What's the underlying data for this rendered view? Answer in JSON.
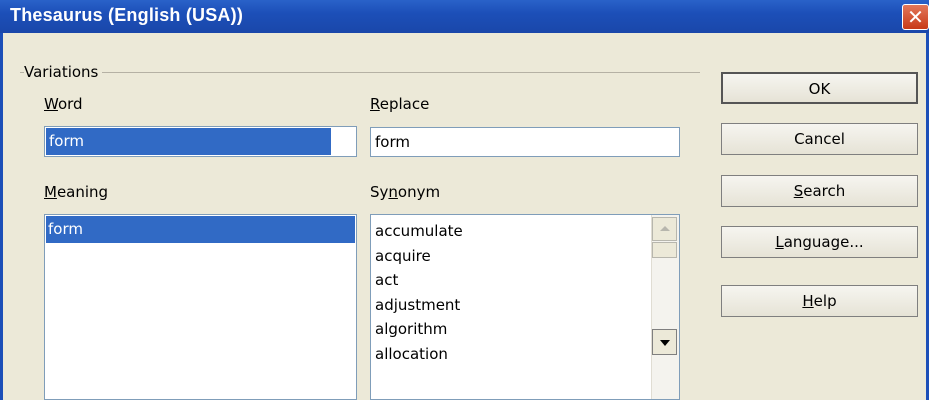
{
  "window": {
    "title": "Thesaurus (English (USA))",
    "close_glyph": "✕"
  },
  "group": {
    "label": "Variations"
  },
  "word": {
    "label_accel": "W",
    "label_rest": "ord",
    "value": "form"
  },
  "replace": {
    "label_accel": "R",
    "label_rest": "eplace",
    "value": "form"
  },
  "meaning": {
    "label_accel": "M",
    "label_rest": "eaning",
    "items": [
      "form"
    ],
    "selected_index": 0
  },
  "synonym": {
    "label_pre": "Sy",
    "label_accel": "n",
    "label_rest": "onym",
    "items": [
      "accumulate",
      "acquire",
      "act",
      "adjustment",
      "algorithm",
      "allocation"
    ]
  },
  "buttons": {
    "ok": {
      "label": "OK"
    },
    "cancel": {
      "label": "Cancel"
    },
    "search": {
      "accel": "S",
      "rest": "earch"
    },
    "language": {
      "accel": "L",
      "rest": "anguage..."
    },
    "help": {
      "accel": "H",
      "rest": "elp"
    }
  },
  "colors": {
    "titlebar": "#1c4fb8",
    "selection": "#316ac5",
    "dialog_bg": "#ece9d8",
    "close": "#c83a18"
  },
  "icons": {
    "close": "close-icon",
    "dropdown": "chevron-down-icon",
    "scroll_up": "scroll-up-icon",
    "scroll_down": "scroll-down-icon"
  }
}
